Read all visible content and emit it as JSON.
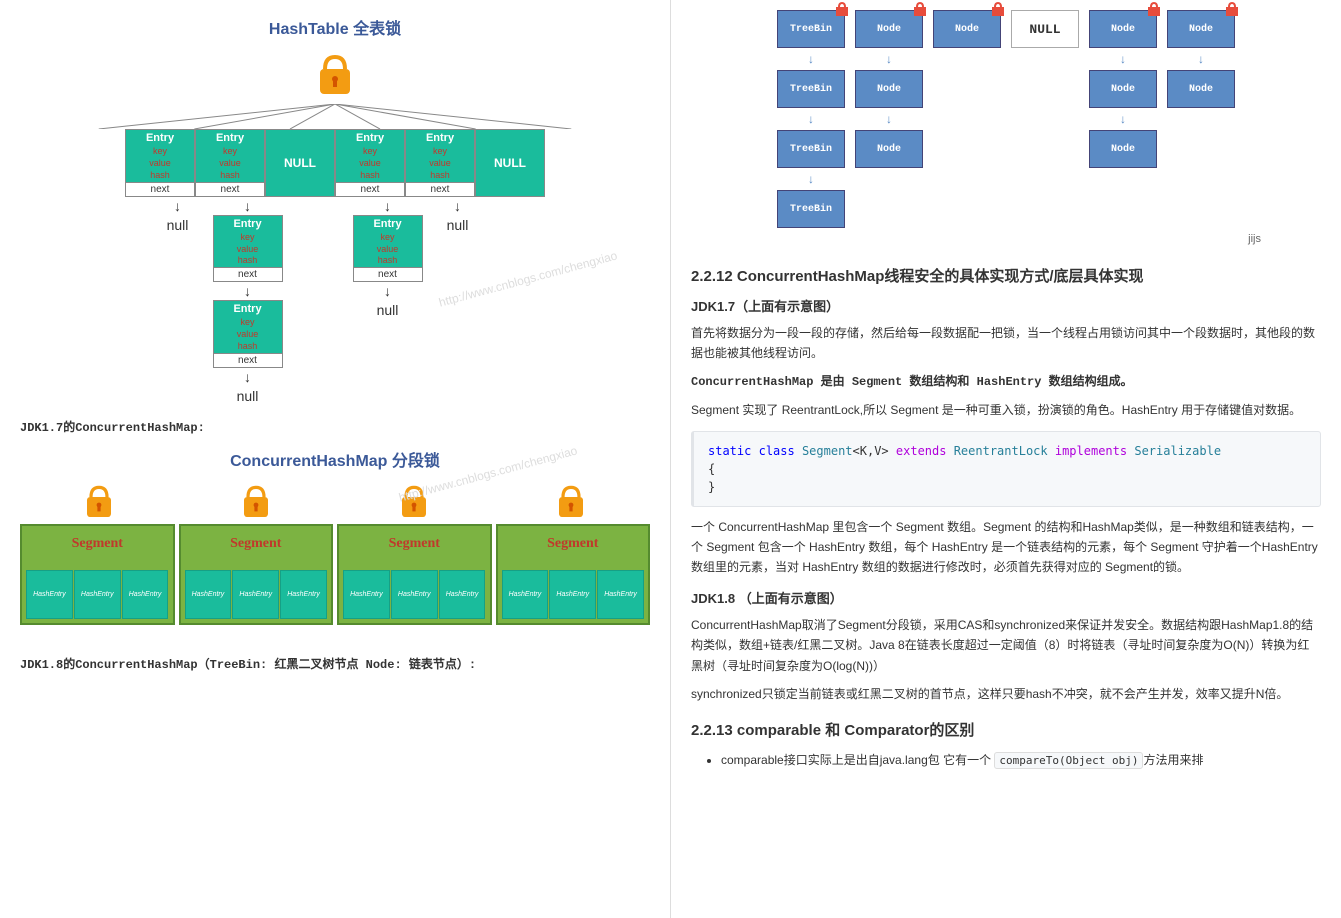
{
  "left": {
    "diag1_title": "HashTable 全表锁",
    "entry_label": "Entry",
    "entry_key": "key",
    "entry_value": "value",
    "entry_hash": "hash",
    "entry_next": "next",
    "null_box": "NULL",
    "null_text": "null",
    "watermark": "http://www.cnblogs.com/chengxiao",
    "caption1": "JDK1.7的ConcurrentHashMap:",
    "diag2_title": "ConcurrentHashMap 分段锁",
    "segment_label": "Segment",
    "hashentry_label": "HashEntry",
    "caption2": "JDK1.8的ConcurrentHashMap（TreeBin: 红黑二叉树节点 Node: 链表节点）:"
  },
  "right": {
    "treebin": "TreeBin",
    "node": "Node",
    "null_bucket": "NULL",
    "jijs": "jijs",
    "h_2212": "2.2.12 ConcurrentHashMap线程安全的具体实现方式/底层具体实现",
    "h_jdk17": "JDK1.7（上面有示意图）",
    "p1": "首先将数据分为一段一段的存储，然后给每一段数据配一把锁，当一个线程占用锁访问其中一个段数据时，其他段的数据也能被其他线程访问。",
    "p2": "ConcurrentHashMap 是由 Segment 数组结构和 HashEntry 数组结构组成。",
    "p3": "Segment 实现了 ReentrantLock,所以 Segment 是一种可重入锁，扮演锁的角色。HashEntry 用于存储键值对数据。",
    "code": {
      "l1_kw1": "static",
      "l1_kw2": "class",
      "l1_cls": "Segment",
      "l1_gen": "<K,V>",
      "l1_ext": "extends",
      "l1_rtype": "ReentrantLock",
      "l1_impl": "implements",
      "l1_ser": "Serializable",
      "l2": "{",
      "l3": "}"
    },
    "p4": "一个 ConcurrentHashMap 里包含一个 Segment 数组。Segment 的结构和HashMap类似，是一种数组和链表结构，一个 Segment 包含一个 HashEntry 数组，每个 HashEntry 是一个链表结构的元素，每个 Segment 守护着一个HashEntry数组里的元素，当对 HashEntry 数组的数据进行修改时，必须首先获得对应的 Segment的锁。",
    "h_jdk18": "JDK1.8 （上面有示意图）",
    "p5": "ConcurrentHashMap取消了Segment分段锁，采用CAS和synchronized来保证并发安全。数据结构跟HashMap1.8的结构类似，数组+链表/红黑二叉树。Java 8在链表长度超过一定阈值（8）时将链表（寻址时间复杂度为O(N)）转换为红黑树（寻址时间复杂度为O(log(N))）",
    "p6": "synchronized只锁定当前链表或红黑二叉树的首节点，这样只要hash不冲突，就不会产生并发，效率又提升N倍。",
    "h_2213": "2.2.13 comparable 和 Comparator的区别",
    "li1_pre": "comparable接口实际上是出自java.lang包 它有一个 ",
    "li1_code": "compareTo(Object obj)",
    "li1_post": "方法用来排"
  }
}
